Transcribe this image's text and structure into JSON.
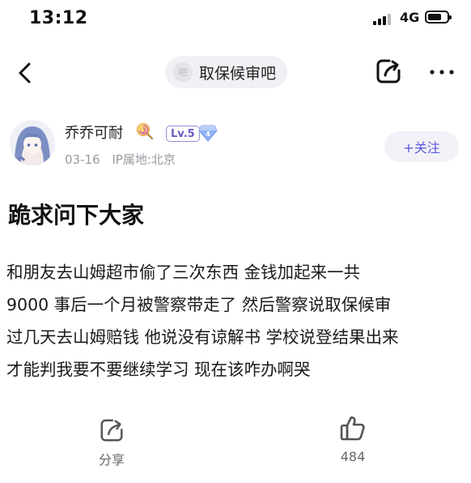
{
  "status_bar": {
    "time": "13:12",
    "network": "4G"
  },
  "nav": {
    "forum_icon_text": "吧",
    "forum_name": "取保候审吧"
  },
  "author": {
    "name": "乔乔可耐",
    "level": "Lv.5",
    "date": "03-16",
    "ip": "IP属地:北京",
    "follow_label": "+关注"
  },
  "post": {
    "title": "跪求问下大家",
    "lines": [
      "和朋友去山姆超市偷了三次东西 金钱加起来一共",
      "9000 事后一个月被警察带走了 然后警察说取保候审",
      "过几天去山姆赔钱 他说没有谅解书 学校说登结果出来",
      "才能判我要不要继续学习 现在该咋办啊哭"
    ]
  },
  "actions": {
    "share_label": "分享",
    "like_count": "484"
  },
  "colors": {
    "accent": "#5a5ae0",
    "level_border": "#9a8bd8",
    "meta_gray": "#9a9aa2"
  }
}
